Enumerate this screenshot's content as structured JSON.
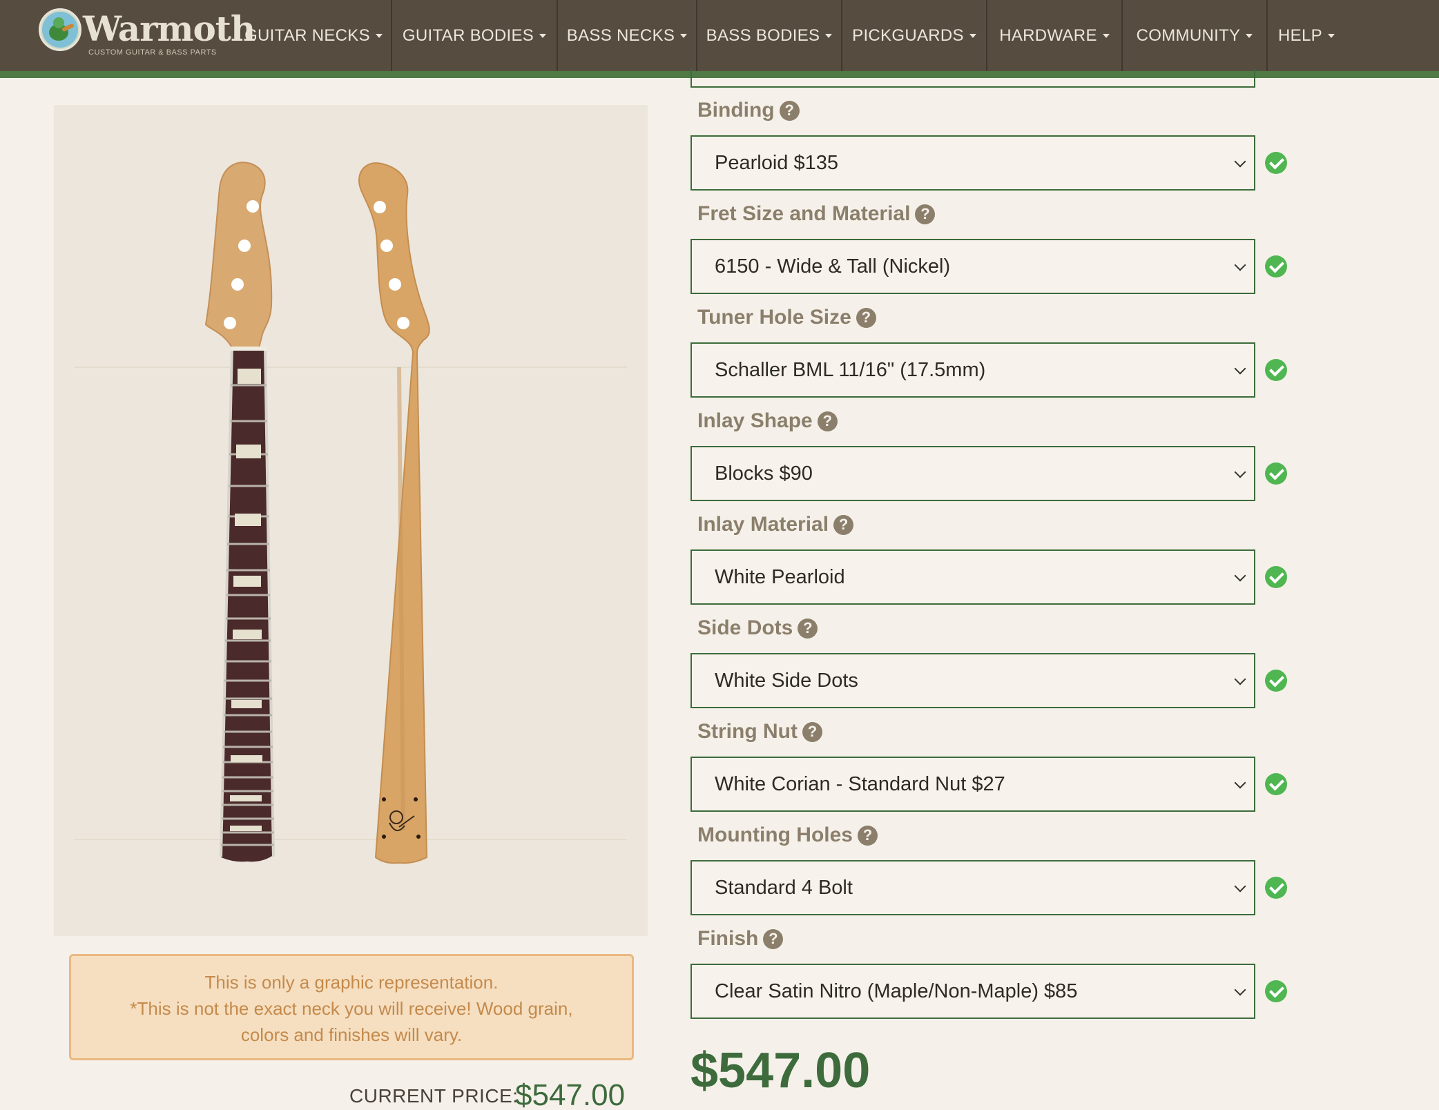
{
  "brand": {
    "name": "Warmoth",
    "tagline": "CUSTOM GUITAR & BASS PARTS"
  },
  "nav": {
    "items": [
      {
        "label": "GUITAR NECKS"
      },
      {
        "label": "GUITAR BODIES"
      },
      {
        "label": "BASS NECKS"
      },
      {
        "label": "BASS BODIES"
      },
      {
        "label": "PICKGUARDS"
      },
      {
        "label": "HARDWARE"
      },
      {
        "label": "COMMUNITY"
      },
      {
        "label": "HELP"
      }
    ]
  },
  "preview": {
    "notice_line1": "This is only a graphic representation.",
    "notice_line2": "*This is not the exact neck you will receive! Wood grain,",
    "notice_line3": "colors and finishes will vary.",
    "current_price_label": "CURRENT PRICE:",
    "current_price_value": "$547.00"
  },
  "options": [
    {
      "label": "Binding",
      "value": "Pearloid $135"
    },
    {
      "label": "Fret Size and Material",
      "value": "6150 - Wide & Tall (Nickel)"
    },
    {
      "label": "Tuner Hole Size",
      "value": "Schaller BML 11/16\" (17.5mm)"
    },
    {
      "label": "Inlay Shape",
      "value": "Blocks $90"
    },
    {
      "label": "Inlay Material",
      "value": "White Pearloid"
    },
    {
      "label": "Side Dots",
      "value": "White Side Dots"
    },
    {
      "label": "String Nut",
      "value": "White Corian - Standard Nut $27"
    },
    {
      "label": "Mounting Holes",
      "value": "Standard 4 Bolt"
    },
    {
      "label": "Finish",
      "value": "Clear Satin Nitro (Maple/Non-Maple) $85"
    }
  ],
  "total_price": "$547.00",
  "colors": {
    "nav_bg": "#564d40",
    "nav_accent": "#4f7a45",
    "label": "#8b7f6b",
    "select_border": "#3c6b3a",
    "check": "#4fb651",
    "price": "#3d6b3c"
  }
}
